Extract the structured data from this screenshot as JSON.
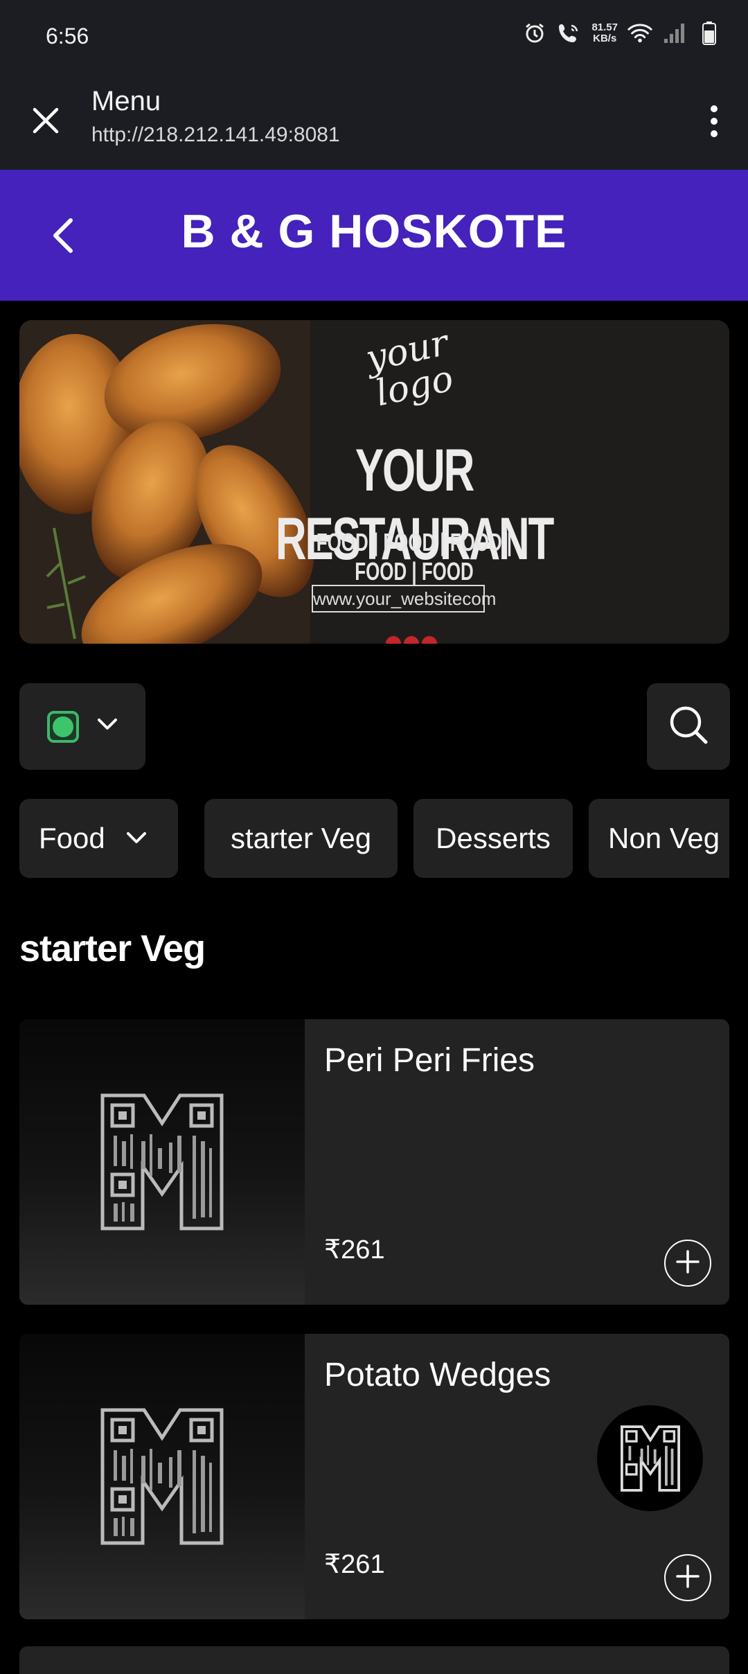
{
  "status_bar": {
    "time": "6:56",
    "speed_value": "81.57",
    "speed_unit": "KB/s",
    "icons": [
      "alarm-icon",
      "wifi-call-icon",
      "wifi-icon",
      "signal-icon",
      "battery-icon"
    ]
  },
  "browser": {
    "title": "Menu",
    "url": "http://218.212.141.49:8081"
  },
  "header": {
    "brand": "B & G HOSKOTE",
    "color": "#4422bb"
  },
  "banner": {
    "logo_line1": "your",
    "logo_line2": "logo",
    "headline": "YOUR RESTAURANT",
    "tagline": "FOOD | FOOD | FOOD | FOOD | FOOD",
    "website": "www.your_websitecom"
  },
  "filters": {
    "diet_filter": "veg",
    "veg_color": "#3ec46b"
  },
  "categories": [
    {
      "label": "Food",
      "dropdown": true
    },
    {
      "label": "starter Veg"
    },
    {
      "label": "Desserts"
    },
    {
      "label": "Non Veg"
    }
  ],
  "section_title": "starter Veg",
  "items": [
    {
      "name": "Peri Peri Fries",
      "price": "₹261"
    },
    {
      "name": "Potato Wedges",
      "price": "₹261"
    }
  ]
}
